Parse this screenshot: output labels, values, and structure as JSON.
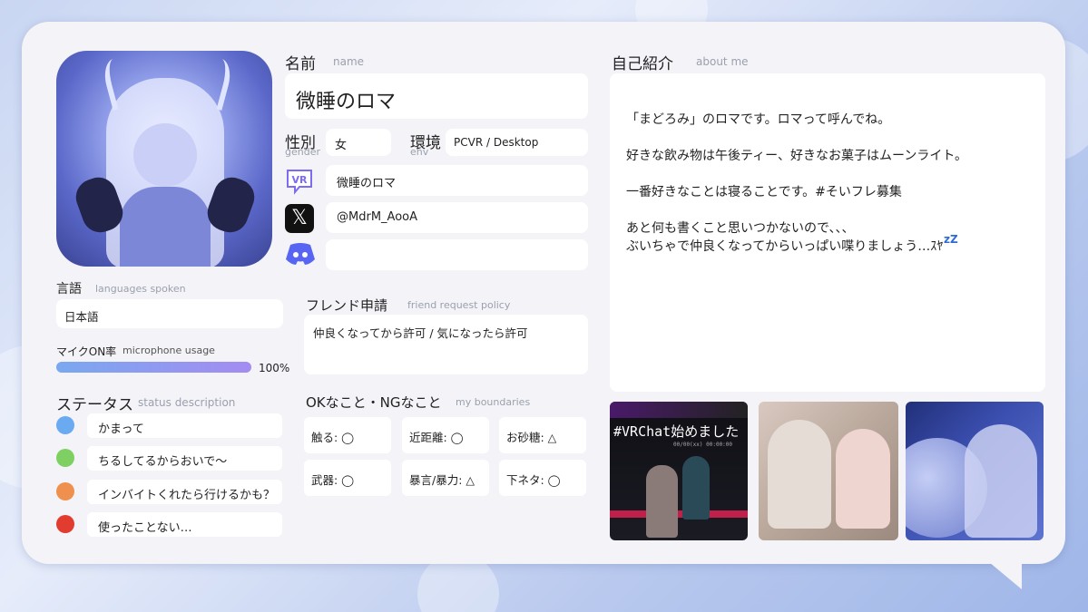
{
  "profile": {
    "name_label": "名前",
    "name_label_en": "name",
    "name": "微睡のロマ",
    "gender_label": "性別",
    "gender_label_en": "gender",
    "gender": "女",
    "env_label": "環境",
    "env_label_en": "env",
    "env": "PCVR / Desktop",
    "vrchat_name": "微睡のロマ",
    "x_handle": "@MdrM_AooA",
    "discord": "",
    "vr_icon_text": "VR",
    "x_icon_text": "𝕏"
  },
  "language": {
    "label": "言語",
    "label_en": "languages spoken",
    "value": "日本語"
  },
  "mic": {
    "label": "マイクON率",
    "label_en": "microphone usage",
    "value_text": "100%",
    "fraction": 1.0
  },
  "status": {
    "label": "ステータス",
    "label_en": "status description",
    "items": [
      {
        "color": "#6aaaf0",
        "text": "かまって"
      },
      {
        "color": "#7fd062",
        "text": "ちるしてるからおいで〜"
      },
      {
        "color": "#f0904e",
        "text": "インバイトくれたら行けるかも？"
      },
      {
        "color": "#e23b30",
        "text": "使ったことない…"
      }
    ]
  },
  "friend": {
    "label": "フレンド申請",
    "label_en": "friend request policy",
    "value": "仲良くなってから許可 / 気になったら許可"
  },
  "boundaries": {
    "label": "OKなこと・NGなこと",
    "label_en": "my boundaries",
    "items": [
      "触る: ◯",
      "近距離: ◯",
      "お砂糖: △",
      "武器: ◯",
      "暴言/暴力: △",
      "下ネタ: ◯"
    ]
  },
  "about": {
    "label": "自己紹介",
    "label_en": "about me",
    "lines": [
      "「まどろみ」のロマです。ロマって呼んでね。",
      "好きな飲み物は午後ティー、好きなお菓子はムーンライト。",
      "一番好きなことは寝ることです。#そいフレ募集",
      "あと何も書くこと思いつかないので、、、",
      "ぶいちゃで仲良くなってからいっぱい喋りましょう…ｽﾔ",
      "zZ"
    ]
  },
  "thumbnails": {
    "t1_title": "#VRChat始めました",
    "t1_sub": "00/00(xx) 00:00:00"
  }
}
